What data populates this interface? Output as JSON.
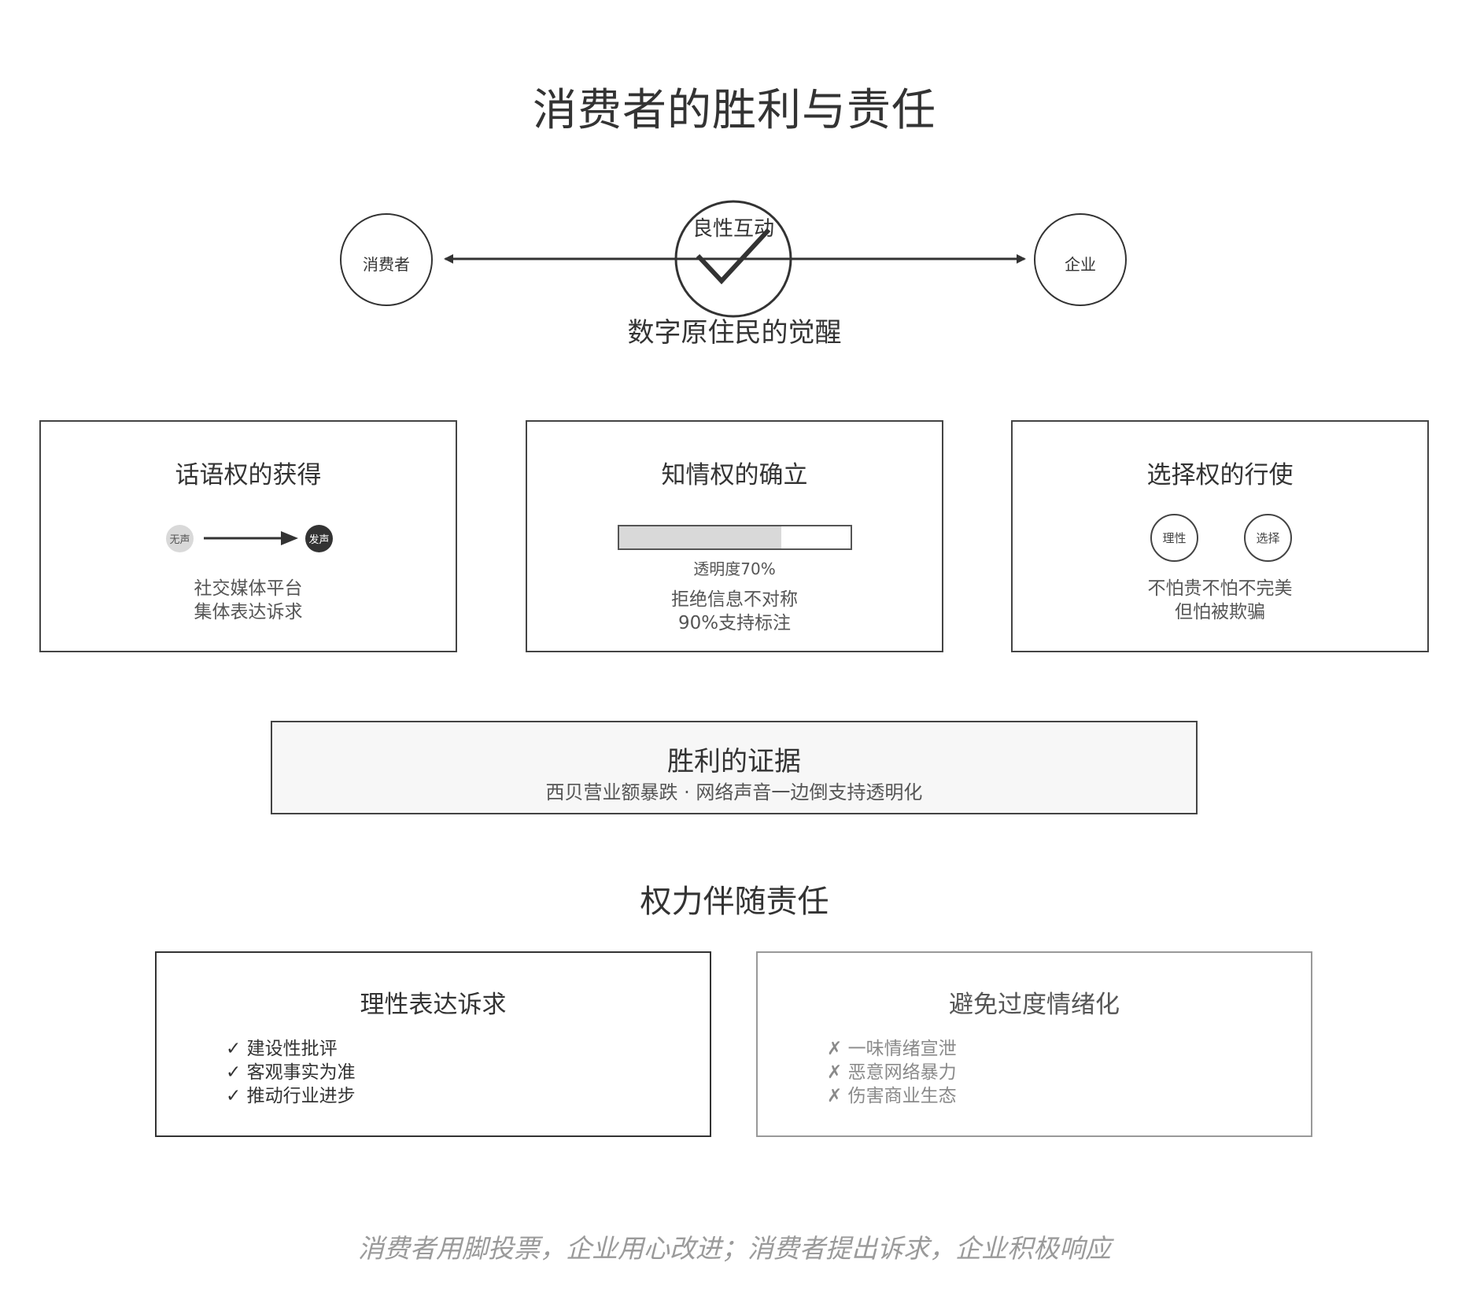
{
  "title": "消费者的胜利与责任",
  "diagram": {
    "left_node": "消费者",
    "right_node": "企业",
    "center_label": "良性互动",
    "center_icon": "check-icon",
    "subtitle": "数字原住民的觉醒"
  },
  "cards": {
    "voice": {
      "title": "话语权的获得",
      "from_label": "无声",
      "to_label": "发声",
      "line1": "社交媒体平台",
      "line2": "集体表达诉求"
    },
    "info": {
      "title": "知情权的确立",
      "progress": 0.7,
      "progress_label": "透明度70%",
      "line1": "拒绝信息不对称",
      "line2": "90%支持标注"
    },
    "choice": {
      "title": "选择权的行使",
      "circle1": "理性",
      "circle2": "选择",
      "line1": "不怕贵不怕不完美",
      "line2": "但怕被欺骗"
    }
  },
  "evidence": {
    "title": "胜利的证据",
    "text": "西贝营业额暴跌 · 网络声音一边倒支持透明化"
  },
  "section2_title": "权力伴随责任",
  "responsibility": {
    "do": {
      "title": "理性表达诉求",
      "mark": "✓",
      "items": [
        "建设性批评",
        "客观事实为准",
        "推动行业进步"
      ]
    },
    "dont": {
      "title": "避免过度情绪化",
      "mark": "✗",
      "items": [
        "一味情绪宣泄",
        "恶意网络暴力",
        "伤害商业生态"
      ]
    }
  },
  "footer": "消费者用脚投票，企业用心改进；消费者提出诉求，企业积极响应",
  "colors": {
    "stroke": "#333333",
    "muted_text": "#8a8a8a",
    "progress_fill": "#d9d9d9",
    "evidence_bg": "#f7f7f7"
  }
}
